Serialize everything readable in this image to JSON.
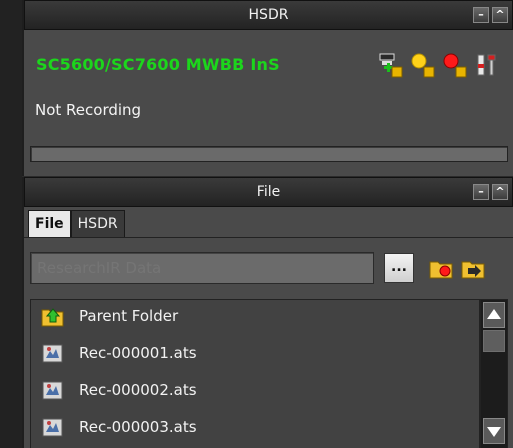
{
  "hsdr_panel": {
    "title": "HSDR",
    "minimize_glyph": "–",
    "maximize_glyph": "^",
    "device_name": "SC5600/SC7600 MWBB InS",
    "device_name_color": "#1cd61c",
    "toolbar_icons": [
      "add-device-icon",
      "connect-yellow-icon",
      "record-red-icon",
      "tools-icon"
    ],
    "recording_status": "Not Recording",
    "progress": 0
  },
  "file_panel": {
    "title": "File",
    "minimize_glyph": "–",
    "maximize_glyph": "^",
    "tabs": [
      {
        "label": "File",
        "active": true
      },
      {
        "label": "HSDR",
        "active": false
      }
    ],
    "path": {
      "placeholder": "ResearchIR Data"
    },
    "browse_label": "...",
    "files": [
      {
        "label": "Parent Folder",
        "icon": "parent-folder-icon"
      },
      {
        "label": "Rec-000001.ats",
        "icon": "recording-file-icon"
      },
      {
        "label": "Rec-000002.ats",
        "icon": "recording-file-icon"
      },
      {
        "label": "Rec-000003.ats",
        "icon": "recording-file-icon"
      }
    ]
  }
}
